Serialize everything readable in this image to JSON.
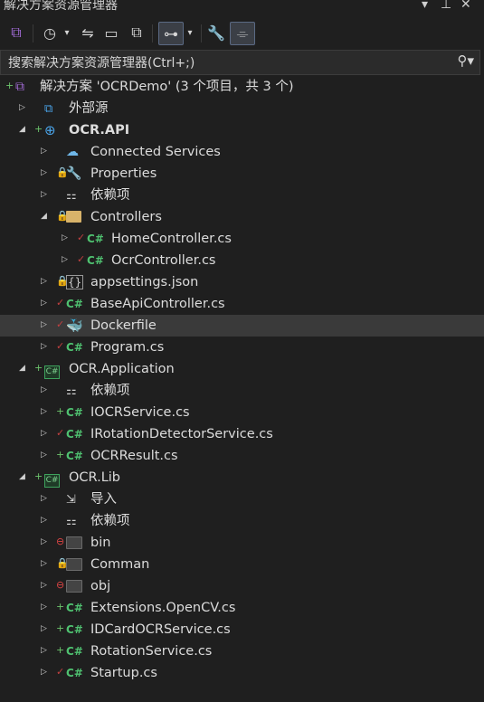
{
  "window": {
    "title": "解决方案资源管理器"
  },
  "search": {
    "placeholder": "搜索解决方案资源管理器(Ctrl+;)"
  },
  "tree": [
    {
      "label": "解决方案 'OCRDemo' (3 个项目，共 3 个)",
      "icon": "solution-icon",
      "bold": false
    },
    {
      "label": "外部源",
      "icon": "external-sources-icon"
    },
    {
      "label": "OCR.API",
      "icon": "web-project-icon",
      "bold": true
    },
    {
      "label": "Connected Services",
      "icon": "connected-services-icon"
    },
    {
      "label": "Properties",
      "icon": "properties-icon"
    },
    {
      "label": "依赖项",
      "icon": "dependencies-icon"
    },
    {
      "label": "Controllers",
      "icon": "folder-icon"
    },
    {
      "label": "HomeController.cs",
      "icon": "csharp-file-icon"
    },
    {
      "label": "OcrController.cs",
      "icon": "csharp-file-icon"
    },
    {
      "label": "appsettings.json",
      "icon": "json-file-icon"
    },
    {
      "label": "BaseApiController.cs",
      "icon": "csharp-file-icon"
    },
    {
      "label": "Dockerfile",
      "icon": "docker-icon"
    },
    {
      "label": "Program.cs",
      "icon": "csharp-file-icon"
    },
    {
      "label": "OCR.Application",
      "icon": "csharp-project-icon"
    },
    {
      "label": "依赖项",
      "icon": "dependencies-icon"
    },
    {
      "label": "IOCRService.cs",
      "icon": "csharp-file-icon"
    },
    {
      "label": "IRotationDetectorService.cs",
      "icon": "csharp-file-icon"
    },
    {
      "label": "OCRResult.cs",
      "icon": "csharp-file-icon"
    },
    {
      "label": "OCR.Lib",
      "icon": "csharp-project-icon"
    },
    {
      "label": "导入",
      "icon": "import-icon"
    },
    {
      "label": "依赖项",
      "icon": "dependencies-icon"
    },
    {
      "label": "bin",
      "icon": "folder-icon"
    },
    {
      "label": "Comman",
      "icon": "folder-icon"
    },
    {
      "label": "obj",
      "icon": "folder-icon"
    },
    {
      "label": "Extensions.OpenCV.cs",
      "icon": "csharp-file-icon"
    },
    {
      "label": "IDCardOCRService.cs",
      "icon": "csharp-file-icon"
    },
    {
      "label": "RotationService.cs",
      "icon": "csharp-file-icon"
    },
    {
      "label": "Startup.cs",
      "icon": "csharp-file-icon"
    }
  ]
}
